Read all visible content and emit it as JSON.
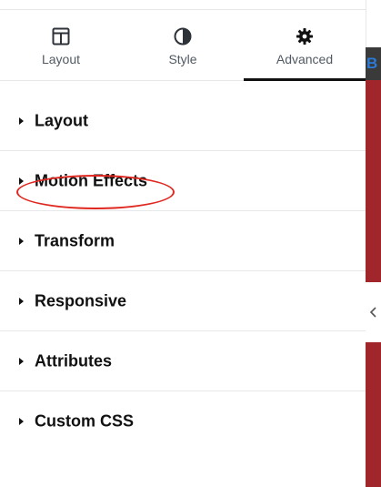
{
  "tabs": [
    {
      "label": "Layout",
      "icon": "columns-icon",
      "active": false
    },
    {
      "label": "Style",
      "icon": "contrast-icon",
      "active": false
    },
    {
      "label": "Advanced",
      "icon": "gear-icon",
      "active": true
    }
  ],
  "sections": [
    {
      "title": "Layout"
    },
    {
      "title": "Motion Effects"
    },
    {
      "title": "Transform"
    },
    {
      "title": "Responsive"
    },
    {
      "title": "Attributes"
    },
    {
      "title": "Custom CSS"
    }
  ],
  "preview": {
    "partial_text": "B"
  },
  "colors": {
    "accent": "#111111",
    "highlight_circle": "#e0271f",
    "preview_red": "#a1262b",
    "preview_link": "#2b7bd6"
  }
}
